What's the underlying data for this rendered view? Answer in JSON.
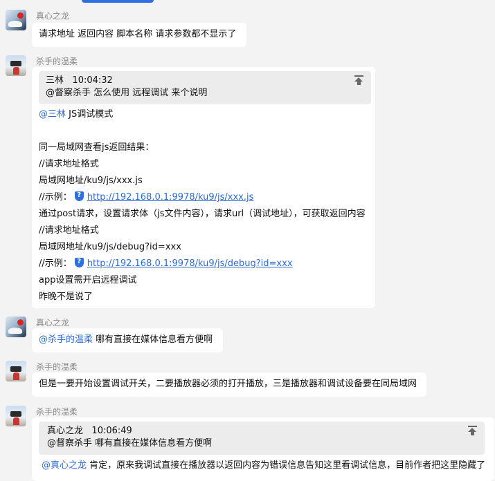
{
  "colors": {
    "accent": "#2d6bd4",
    "mention": "#2d6bd4",
    "background": "#f3f3f3"
  },
  "messages": [
    {
      "sender": "真心之龙",
      "avatar": "dragon-avatar",
      "lines": [
        "请求地址 返回内容 脚本名称 请求参数都不显示了"
      ]
    },
    {
      "sender": "杀手的温柔",
      "avatar": "killer-avatar",
      "quote": {
        "author": "三林",
        "time": "10:04:32",
        "text": "@督察杀手 怎么使用 远程调试 来个说明"
      },
      "mention": "@三林",
      "mention_rest": " JS调试模式",
      "lines": [
        "同一局域网查看js返回结果：",
        "//请求地址格式",
        "局域网地址/ku9/js/xxx.js",
        "//示例：",
        "通过post请求，设置请求体（js文件内容），请求url（调试地址），可获取返回内容",
        "//请求地址格式",
        "局域网地址/ku9/js/debug?id=xxx",
        "//示例：",
        "app设置需开启远程调试",
        "昨晚不是说了"
      ],
      "links": [
        "http://192.168.0.1:9978/ku9/js/xxx.js",
        "http://192.168.0.1:9978/ku9/js/debug?id=xxx"
      ]
    },
    {
      "sender": "真心之龙",
      "avatar": "dragon-avatar",
      "mention": "@杀手的温柔",
      "mention_rest": " 哪有直接在媒体信息看方便啊"
    },
    {
      "sender": "杀手的温柔",
      "avatar": "killer-avatar",
      "lines": [
        "但是一要开始设置调试开关，二要播放器必须的打开播放，三是播放器和调试设备要在同局域网"
      ]
    },
    {
      "sender": "杀手的温柔",
      "avatar": "killer-avatar",
      "quote": {
        "author": "真心之龙",
        "time": "10:06:49",
        "text": "@督察杀手 哪有直接在媒体信息看方便啊"
      },
      "mention": "@真心之龙",
      "mention_rest": " 肯定，原来我调试直接在播放器以返回内容为错误信息告知这里看调试信息，目前作者把这里隐藏了"
    }
  ]
}
